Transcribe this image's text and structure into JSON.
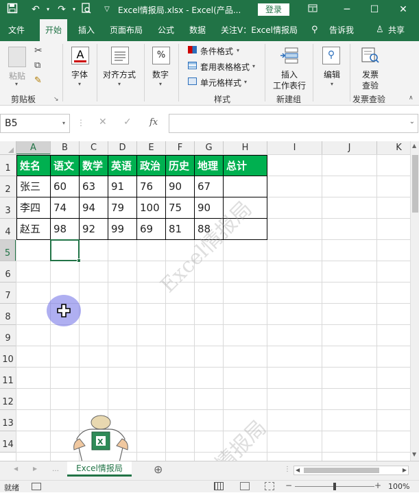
{
  "titlebar": {
    "title": "Excel情报局.xlsx  -  Excel(产品...",
    "login": "登录"
  },
  "tabs": [
    "文件",
    "开始",
    "插入",
    "页面布局",
    "公式",
    "数据",
    "关注V：Excel情报局",
    "告诉我",
    "共享"
  ],
  "ribbon": {
    "paste": "粘贴",
    "clipboard": "剪贴板",
    "font": "字体",
    "align": "对齐方式",
    "number": "数字",
    "percent": "%",
    "cond_format": "条件格式",
    "table_format": "套用表格格式",
    "cell_style": "单元格样式",
    "styles": "样式",
    "insert_l1": "插入",
    "insert_l2": "工作表行",
    "new_group": "新建组",
    "edit": "编辑",
    "publish_l1": "发票",
    "publish_l2": "查验",
    "publish_group": "发票查验"
  },
  "formula_bar": {
    "namebox": "B5",
    "fx": "fx",
    "value": ""
  },
  "columns": [
    "A",
    "B",
    "C",
    "D",
    "E",
    "F",
    "G",
    "H",
    "I",
    "J",
    "K"
  ],
  "rows": [
    "1",
    "2",
    "3",
    "4",
    "5",
    "6",
    "7",
    "8",
    "9",
    "10",
    "11",
    "12",
    "13",
    "14"
  ],
  "table": {
    "header": [
      "姓名",
      "语文",
      "数学",
      "英语",
      "政治",
      "历史",
      "地理",
      "总计"
    ],
    "body": [
      [
        "张三",
        "60",
        "63",
        "91",
        "76",
        "90",
        "67",
        ""
      ],
      [
        "李四",
        "74",
        "94",
        "79",
        "100",
        "75",
        "90",
        ""
      ],
      [
        "赵五",
        "98",
        "92",
        "99",
        "69",
        "81",
        "88",
        ""
      ]
    ]
  },
  "watermark": "Excel情报局",
  "watermark2": "情报局",
  "sheet": {
    "name": "Excel情报局",
    "add": "⊕"
  },
  "status": {
    "ready": "就绪",
    "zoom": "100%"
  },
  "colors": {
    "accent": "#217346",
    "header_fill": "#00b050"
  }
}
